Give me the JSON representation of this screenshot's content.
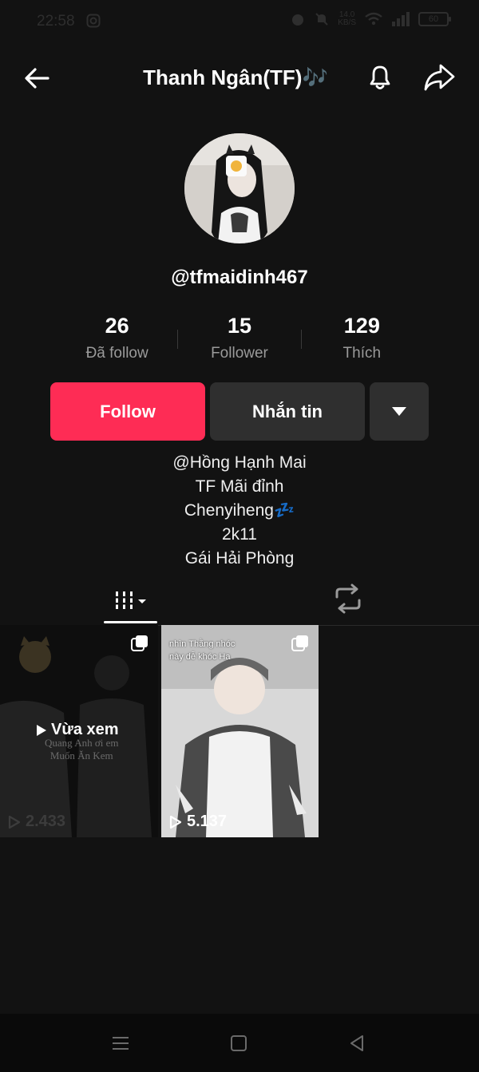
{
  "status_bar": {
    "time": "22:58",
    "network_speed": "14.0",
    "network_unit": "KB/S",
    "battery": "60"
  },
  "header": {
    "title": "Thanh Ngân(TF)🎶"
  },
  "profile": {
    "username": "@tfmaidinh467",
    "stats": [
      {
        "value": "26",
        "label": "Đã follow"
      },
      {
        "value": "15",
        "label": "Follower"
      },
      {
        "value": "129",
        "label": "Thích"
      }
    ],
    "follow_label": "Follow",
    "message_label": "Nhắn tin",
    "bio": [
      "@Hồng Hạnh Mai",
      "TF Mãi đỉnh",
      "Chenyiheng💤",
      "2k11",
      "Gái Hải Phòng"
    ]
  },
  "videos": [
    {
      "views": "2.433",
      "watched_label": "Vừa xem",
      "overlay_line1": "Quang Anh ơi em",
      "overlay_line2": "Muốn Ăn Kem"
    },
    {
      "views": "5.137",
      "caption_line1": "nhìn Thằng nhóc",
      "caption_line2": "này dễ khóc Ha"
    }
  ],
  "colors": {
    "background": "#121212",
    "follow": "#fe2c55",
    "secondary_button": "#2f2f2f"
  }
}
